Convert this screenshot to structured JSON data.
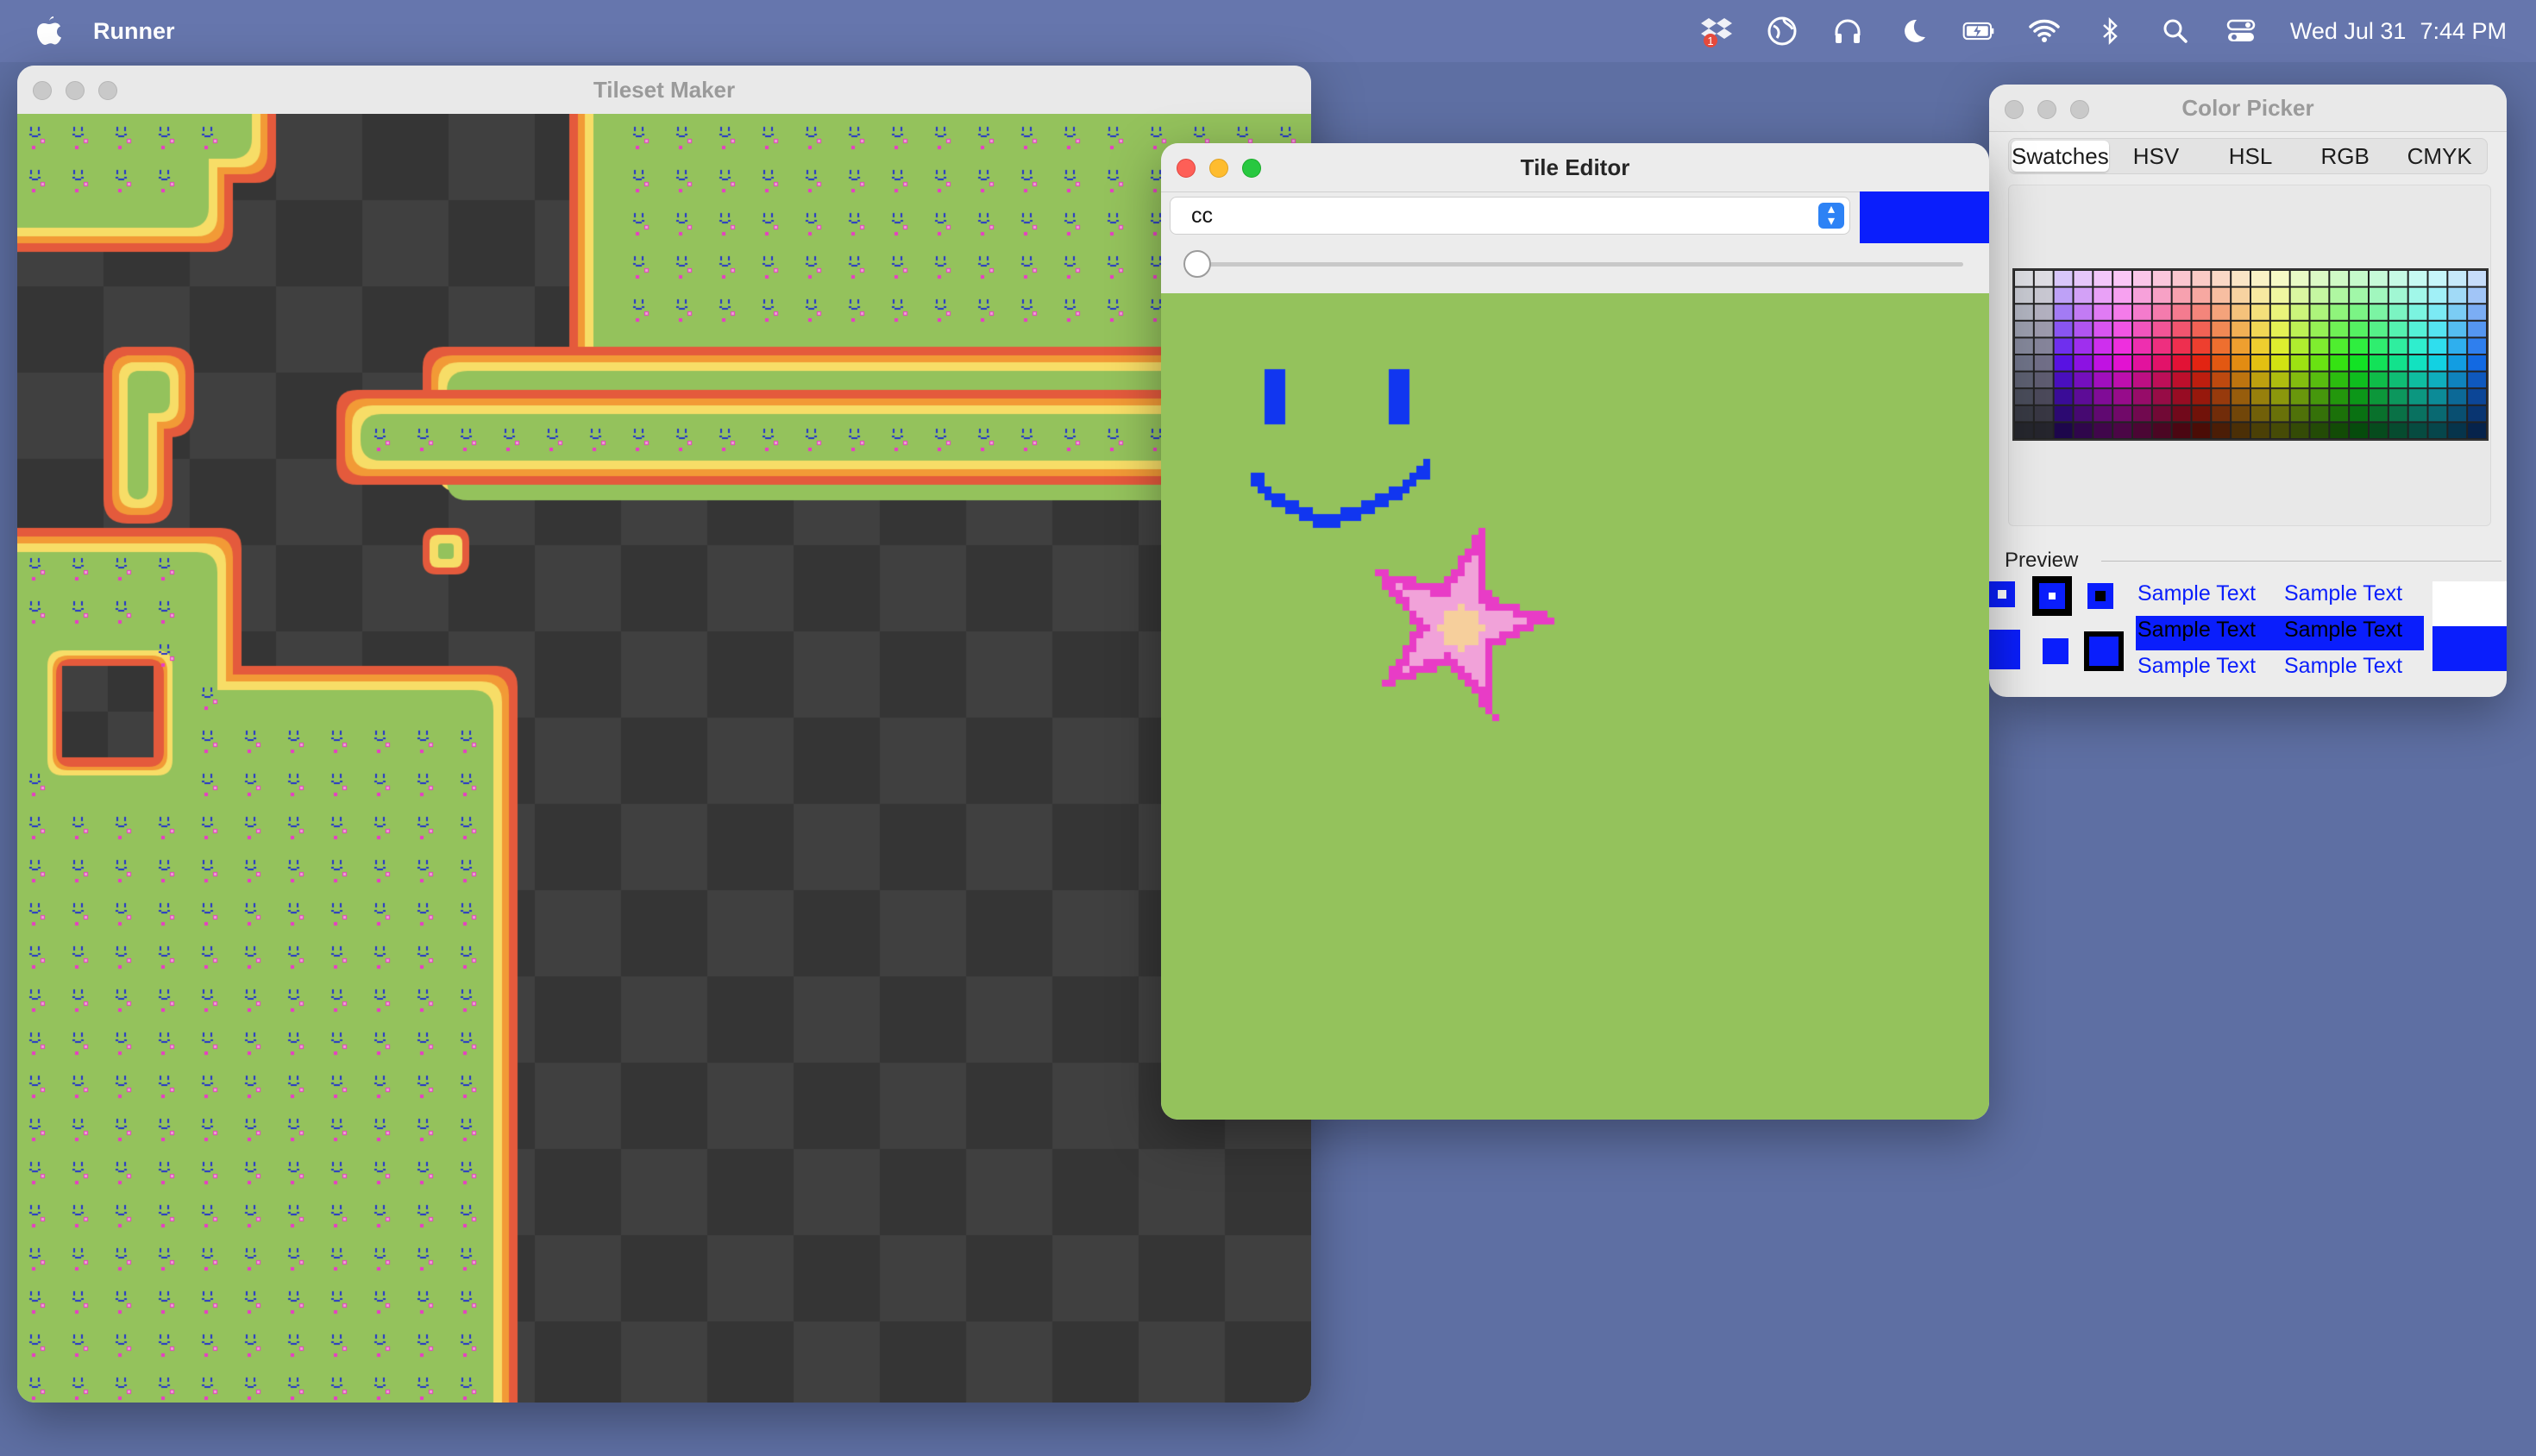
{
  "menubar": {
    "app_name": "Runner",
    "date": "Wed Jul 31",
    "time": "7:44 PM",
    "icons": [
      "apple-icon",
      "dropbox-icon",
      "globe-icon",
      "headphones-icon",
      "moon-icon",
      "battery-icon",
      "wifi-icon",
      "bluetooth-icon",
      "search-icon",
      "control-center-icon"
    ]
  },
  "tileset_window": {
    "title": "Tileset Maker"
  },
  "tile_editor": {
    "title": "Tile Editor",
    "tile_name": "cc",
    "current_color": "#0a1efc",
    "slider_value": 0
  },
  "color_picker": {
    "title": "Color Picker",
    "tabs": [
      "Swatches",
      "HSV",
      "HSL",
      "RGB",
      "CMYK"
    ],
    "active_tab": "Swatches",
    "preview_label": "Preview",
    "sample_text": "Sample Text",
    "selected_color": "#0a1efc"
  },
  "colors": {
    "grass": "#94c25c",
    "dark1": "#353535",
    "dark2": "#404040",
    "border_red": "#e45a3c",
    "border_orange": "#f29a36",
    "border_yellow": "#f7dd67",
    "smile_blue": "#1136f0",
    "star_pink": "#e83cc6",
    "star_light": "#f1a2d9",
    "star_center": "#f6cf9c"
  }
}
